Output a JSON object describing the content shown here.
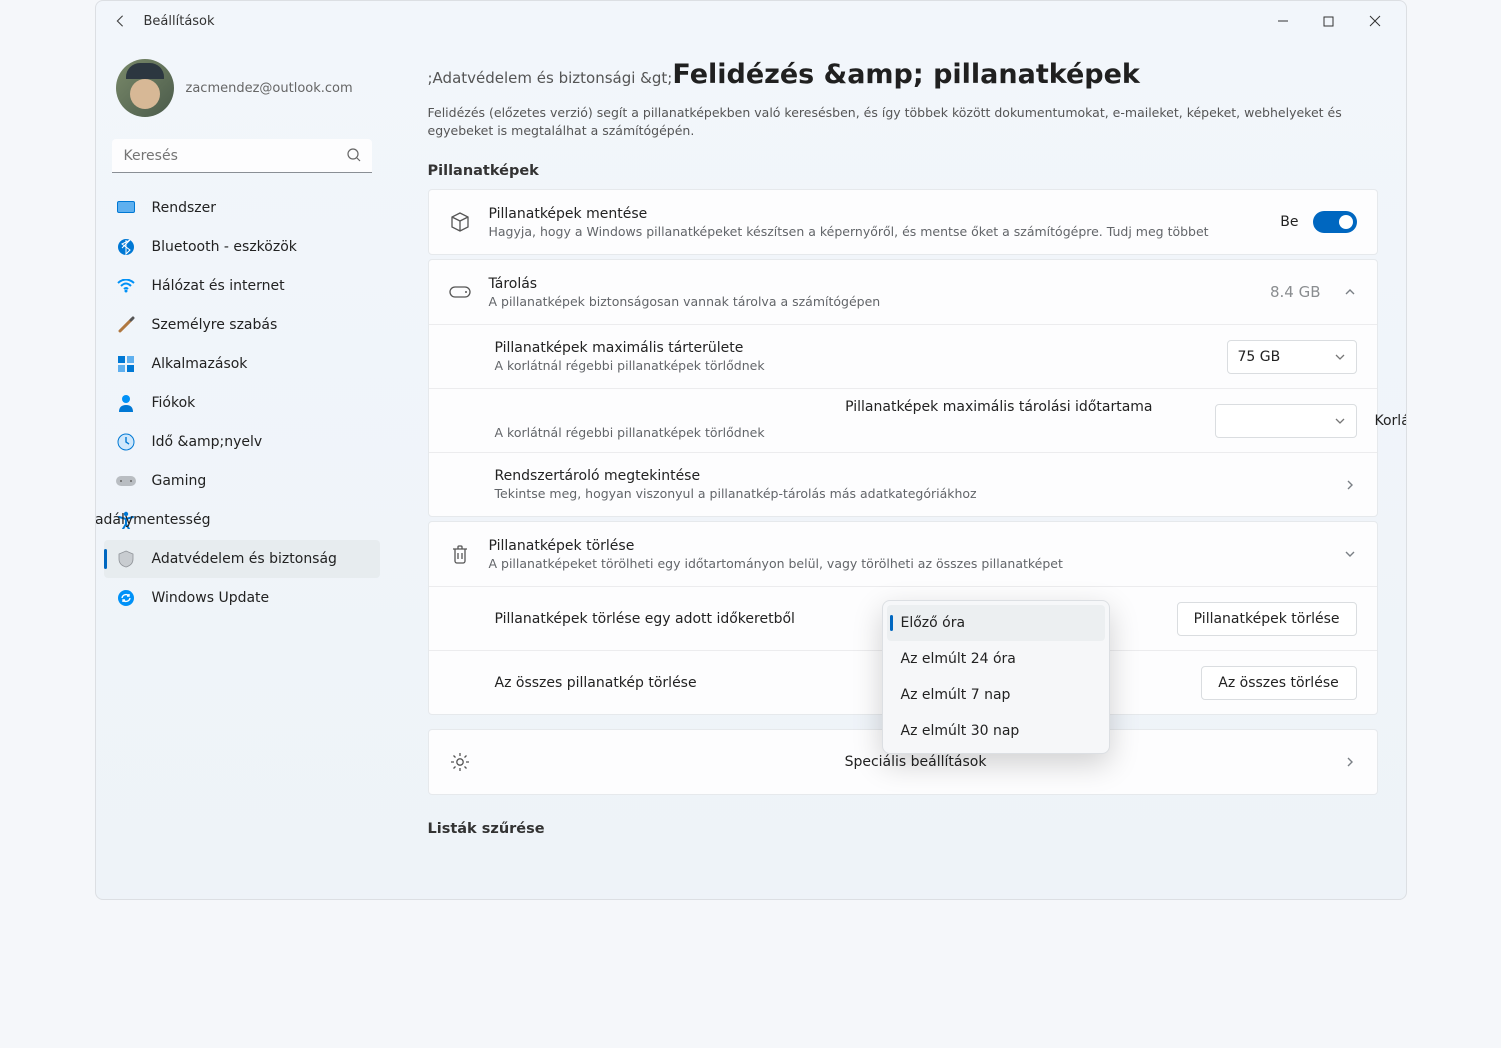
{
  "app": {
    "title": "Beállítások"
  },
  "profile": {
    "email": "zacmendez@outlook.com"
  },
  "search": {
    "placeholder": "Keresés"
  },
  "nav": [
    {
      "id": "system",
      "label": "Rendszer"
    },
    {
      "id": "bluetooth",
      "label": "Bluetooth - eszközök"
    },
    {
      "id": "network",
      "label": "Hálózat és internet"
    },
    {
      "id": "personalization",
      "label": "Személyre szabás"
    },
    {
      "id": "apps",
      "label": "Alkalmazások"
    },
    {
      "id": "accounts",
      "label": "Fiókok"
    },
    {
      "id": "time",
      "label": "Idő &amp;nyelv"
    },
    {
      "id": "gaming",
      "label": "Gaming"
    },
    {
      "id": "accessibility",
      "label": "Akadálymentesség"
    },
    {
      "id": "privacy",
      "label": "Adatvédelem és biztonság"
    },
    {
      "id": "update",
      "label": "Windows Update"
    }
  ],
  "header": {
    "crumb": ";Adatvédelem és biztonsági &gt;",
    "title": "Felidézés &amp; pillanatképek",
    "desc": "Felidézés (előzetes verzió) segít a pillanatképekben való keresésben, és így többek között dokumentumokat, e-maileket, képeket, webhelyeket és egyebeket is megtalálhat a számítógépén."
  },
  "sections": {
    "snapshots_h": "Pillanatképek",
    "save": {
      "title": "Pillanatképek mentése",
      "sub": "Hagyja, hogy a Windows pillanatképeket készítsen a képernyőről, és mentse őket a számítógépre. Tudj meg többet",
      "state": "Be"
    },
    "storage": {
      "title": "Tárolás",
      "sub": "A pillanatképek biztonságosan vannak tárolva a számítógépen",
      "value": "8.4 GB"
    },
    "maxspace": {
      "title": "Pillanatképek maximális tárterülete",
      "sub": "A korlátnál régebbi pillanatképek törlődnek",
      "value": "75 GB"
    },
    "maxtime": {
      "title": "Pillanatképek maximális tárolási időtartama",
      "sub": "A korlátnál régebbi pillanatképek törlődnek",
      "value": "Korlátlan"
    },
    "viewstore": {
      "title": "Rendszertároló megtekintése",
      "sub": "Tekintse meg, hogyan viszonyul a pillanatkép-tárolás más adatkategóriákhoz"
    },
    "delete": {
      "title": "Pillanatképek törlése",
      "sub": "A pillanatképeket törölheti egy időtartományon belül, vagy törölheti az összes pillanatképet"
    },
    "delrange": {
      "title": "Pillanatképek törlése egy adott időkeretből",
      "button": "Pillanatképek törlése",
      "options": [
        "Előző óra",
        "Az elmúlt 24 óra",
        "Az elmúlt 7 nap",
        "Az elmúlt 30 nap"
      ]
    },
    "delall": {
      "title": "Az összes pillanatkép törlése",
      "button": "Az összes törlése"
    },
    "advanced": {
      "title": "Speciális beállítások"
    },
    "filter_h": "Listák szűrése"
  }
}
